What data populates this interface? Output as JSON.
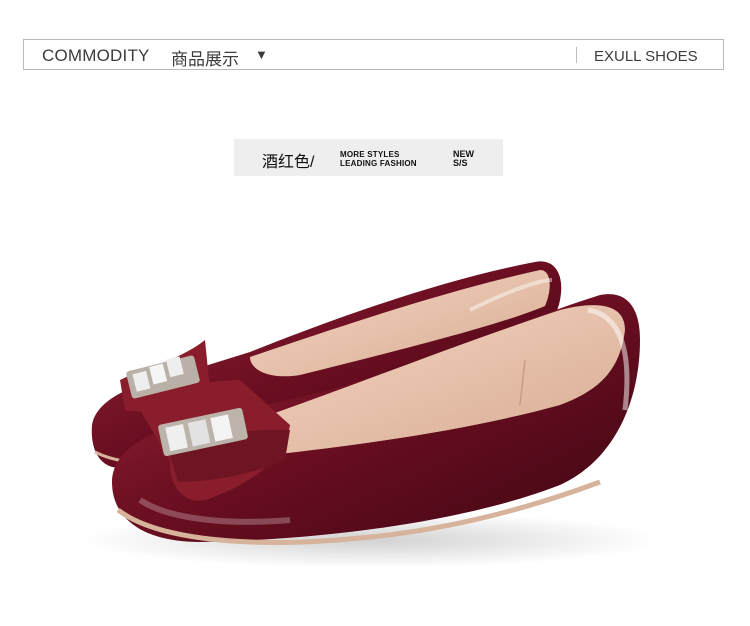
{
  "header": {
    "title": "COMMODITY",
    "title_cn": "商品展示",
    "arrow": "▼",
    "brand": "EXULL SHOES"
  },
  "product_label": {
    "color_name": "酒红色/",
    "line1": "MORE STYLES",
    "line2": "LEADING FASHION",
    "new_line1": "NEW",
    "new_line2": "S/S"
  },
  "product_image": {
    "icon": "burgundy-patent-bow-flat-shoes",
    "colors": {
      "patent": "#6e0f22",
      "patent_dark": "#3d0612",
      "bow": "#8a1d2c",
      "lining": "#ecc7b2",
      "sole": "#d6b39a",
      "crystal": "#e6e6e6"
    }
  }
}
